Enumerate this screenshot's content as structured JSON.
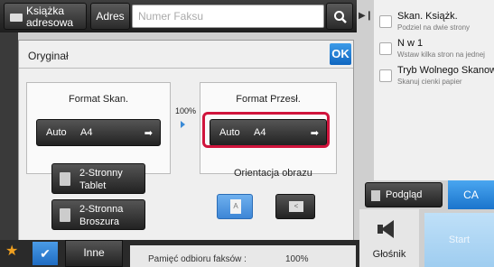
{
  "header": {
    "address_book_label": "Książka adresowa",
    "address_button_label": "Adres",
    "fax_placeholder": "Numer Faksu"
  },
  "right_panel": {
    "items": [
      {
        "title": "Skan. Książk.",
        "subtitle": "Podziel na dwie strony"
      },
      {
        "title": "N w 1",
        "subtitle": "Wstaw kilka stron na jednej"
      },
      {
        "title": "Tryb Wolnego Skanowania",
        "subtitle": "Skanuj cienki papier"
      }
    ]
  },
  "dialog": {
    "title": "Oryginał",
    "ok_label": "OK",
    "scan_format": {
      "header": "Format Skan.",
      "mode": "Auto",
      "size": "A4"
    },
    "ratio": "100%",
    "send_format": {
      "header": "Format Przesł.",
      "mode": "Auto",
      "size": "A4"
    },
    "duplex_tablet": "2-Stronny Tablet",
    "duplex_booklet": "2-Stronna Broszura",
    "orientation_label": "Orientacja obrazu",
    "orientation_a": "A"
  },
  "actions": {
    "preview_label": "Podgląd",
    "ca_label": "CA",
    "speaker_label": "Głośnik",
    "start_label": "Start"
  },
  "bottom": {
    "other_label": "Inne",
    "memory_label": "Pamięć odbioru faksów :",
    "memory_value": "100%"
  },
  "colors": {
    "accent_blue": "#1f6cc2",
    "highlight_red": "#d0143c",
    "star_orange": "#f0a020"
  }
}
